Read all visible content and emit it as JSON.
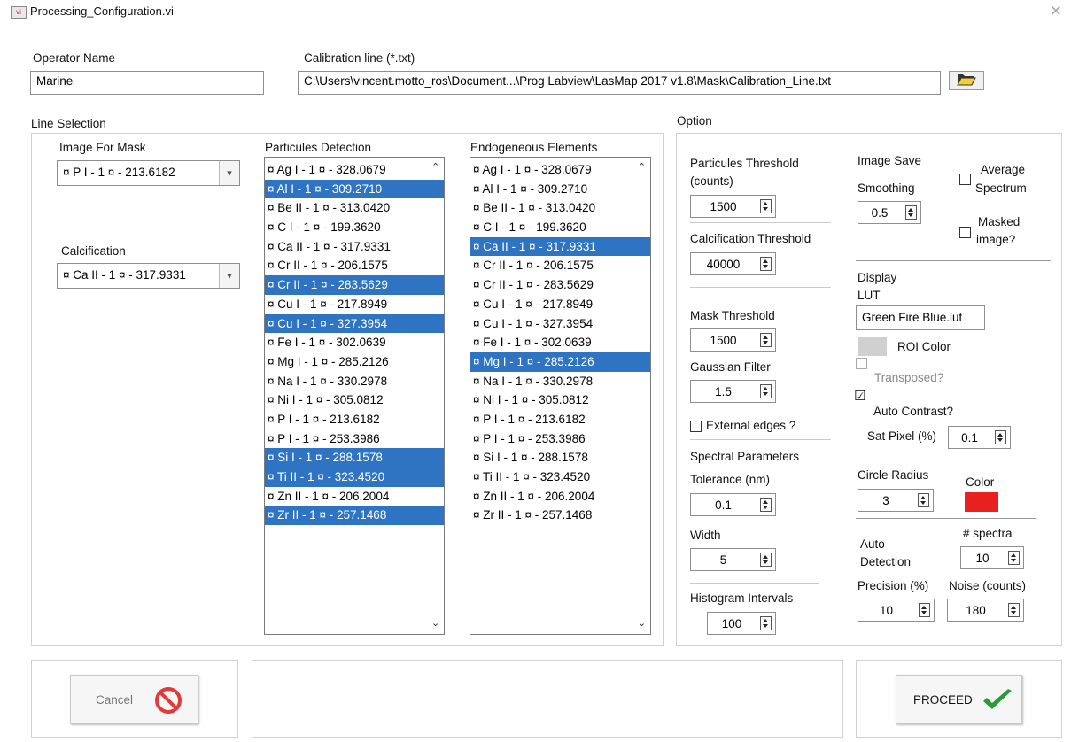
{
  "window": {
    "title": "Processing_Configuration.vi",
    "icon_text": "vi"
  },
  "operator": {
    "label": "Operator Name",
    "value": "Marine"
  },
  "calibration": {
    "label": "Calibration line (*.txt)",
    "value": "C:\\Users\\vincent.motto_ros\\Document...\\Prog Labview\\LasMap 2017 v1.8\\Mask\\Calibration_Line.txt"
  },
  "line_selection": {
    "label": "Line Selection",
    "image_for_mask": {
      "label": "Image For Mask",
      "value": "¤ P  I - 1 ¤ - 213.6182"
    },
    "calcification": {
      "label": "Calcification",
      "value": "¤ Ca  II - 1 ¤ - 317.9331"
    },
    "particules": {
      "label": "Particules Detection",
      "items": [
        {
          "text": "¤ Ag  I - 1 ¤ - 328.0679",
          "selected": false
        },
        {
          "text": "¤ Al  I - 1 ¤ - 309.2710",
          "selected": true
        },
        {
          "text": "¤ Be  II - 1 ¤ - 313.0420",
          "selected": false
        },
        {
          "text": "¤ C  I - 1 ¤ - 199.3620",
          "selected": false
        },
        {
          "text": "¤ Ca  II - 1 ¤ - 317.9331",
          "selected": false
        },
        {
          "text": "¤ Cr  II - 1 ¤ - 206.1575",
          "selected": false
        },
        {
          "text": "¤ Cr  II - 1 ¤ - 283.5629",
          "selected": true
        },
        {
          "text": "¤ Cu  I - 1 ¤ - 217.8949",
          "selected": false
        },
        {
          "text": "¤ Cu  I - 1 ¤ - 327.3954",
          "selected": true
        },
        {
          "text": "¤ Fe  I - 1 ¤ - 302.0639",
          "selected": false
        },
        {
          "text": "¤ Mg  I - 1 ¤ - 285.2126",
          "selected": false
        },
        {
          "text": "¤ Na  I - 1 ¤ - 330.2978",
          "selected": false
        },
        {
          "text": "¤ Ni  I - 1 ¤ - 305.0812",
          "selected": false
        },
        {
          "text": "¤ P  I - 1 ¤ - 213.6182",
          "selected": false
        },
        {
          "text": "¤ P  I - 1 ¤ - 253.3986",
          "selected": false
        },
        {
          "text": "¤ Si  I - 1 ¤ - 288.1578",
          "selected": true
        },
        {
          "text": "¤ Ti  II - 1 ¤ - 323.4520",
          "selected": true
        },
        {
          "text": "¤ Zn  II - 1 ¤ - 206.2004",
          "selected": false
        },
        {
          "text": "¤ Zr  II - 1 ¤ - 257.1468",
          "selected": true
        }
      ]
    },
    "endogeneous": {
      "label": "Endogeneous Elements",
      "items": [
        {
          "text": "¤ Ag  I - 1 ¤ - 328.0679",
          "selected": false
        },
        {
          "text": "¤ Al  I - 1 ¤ - 309.2710",
          "selected": false
        },
        {
          "text": "¤ Be  II - 1 ¤ - 313.0420",
          "selected": false
        },
        {
          "text": "¤ C  I - 1 ¤ - 199.3620",
          "selected": false
        },
        {
          "text": "¤ Ca  II - 1 ¤ - 317.9331",
          "selected": true
        },
        {
          "text": "¤ Cr  II - 1 ¤ - 206.1575",
          "selected": false
        },
        {
          "text": "¤ Cr  II - 1 ¤ - 283.5629",
          "selected": false
        },
        {
          "text": "¤ Cu  I - 1 ¤ - 217.8949",
          "selected": false
        },
        {
          "text": "¤ Cu  I - 1 ¤ - 327.3954",
          "selected": false
        },
        {
          "text": "¤ Fe  I - 1 ¤ - 302.0639",
          "selected": false
        },
        {
          "text": "¤ Mg  I - 1 ¤ - 285.2126",
          "selected": true
        },
        {
          "text": "¤ Na  I - 1 ¤ - 330.2978",
          "selected": false
        },
        {
          "text": "¤ Ni  I - 1 ¤ - 305.0812",
          "selected": false
        },
        {
          "text": "¤ P  I - 1 ¤ - 213.6182",
          "selected": false
        },
        {
          "text": "¤ P  I - 1 ¤ - 253.3986",
          "selected": false
        },
        {
          "text": "¤ Si  I - 1 ¤ - 288.1578",
          "selected": false
        },
        {
          "text": "¤ Ti  II - 1 ¤ - 323.4520",
          "selected": false
        },
        {
          "text": "¤ Zn  II - 1 ¤ - 206.2004",
          "selected": false
        },
        {
          "text": "¤ Zr  II - 1 ¤ - 257.1468",
          "selected": false
        }
      ]
    }
  },
  "option": {
    "label": "Option",
    "particules_threshold": {
      "label_line1": "Particules Threshold",
      "label_line2": "(counts)",
      "value": "1500"
    },
    "calcification_threshold": {
      "label": "Calcification Threshold",
      "value": "40000"
    },
    "mask_threshold": {
      "label": "Mask Threshold",
      "value": "1500"
    },
    "gaussian_filter": {
      "label": "Gaussian Filter",
      "value": "1.5"
    },
    "external_edges": {
      "label": "External edges ?",
      "checked": false
    },
    "spectral_parameters": {
      "label": "Spectral Parameters"
    },
    "tolerance": {
      "label": "Tolerance (nm)",
      "value": "0.1"
    },
    "width": {
      "label": "Width",
      "value": "5"
    },
    "histogram_intervals": {
      "label": "Histogram Intervals",
      "value": "100"
    },
    "image_save": {
      "label": "Image Save"
    },
    "smoothing": {
      "label": "Smoothing",
      "value": "0.5"
    },
    "average_spectrum": {
      "label_line1": "Average",
      "label_line2": "Spectrum",
      "checked": false
    },
    "masked_image": {
      "label_line1": "Masked",
      "label_line2": "image?",
      "checked": false
    },
    "display": {
      "label": "Display"
    },
    "lut": {
      "label": "LUT",
      "value": "Green Fire Blue.lut"
    },
    "roi_color": {
      "label": "ROI Color",
      "color": "#d0d0d0"
    },
    "transposed": {
      "label": "Transposed?",
      "checked": false
    },
    "auto_contrast": {
      "label": "Auto Contrast?",
      "checked": true,
      "mark": "☑"
    },
    "sat_pixel": {
      "label": "Sat Pixel (%)",
      "value": "0.1"
    },
    "circle_radius": {
      "label": "Circle Radius",
      "value": "3"
    },
    "color": {
      "label": "Color",
      "swatch": "#e82020"
    },
    "auto_detection": {
      "label_line1": "Auto",
      "label_line2": "Detection"
    },
    "n_spectra": {
      "label": "# spectra",
      "value": "10"
    },
    "precision": {
      "label": "Precision (%)",
      "value": "10"
    },
    "noise": {
      "label": "Noise (counts)",
      "value": "180"
    }
  },
  "buttons": {
    "cancel": {
      "label": "Cancel"
    },
    "proceed": {
      "label": "PROCEED"
    }
  },
  "colors": {
    "selection": "#2e74c2",
    "proceed_check": "#2a9a3a",
    "cancel_icon": "#e03a3a"
  }
}
